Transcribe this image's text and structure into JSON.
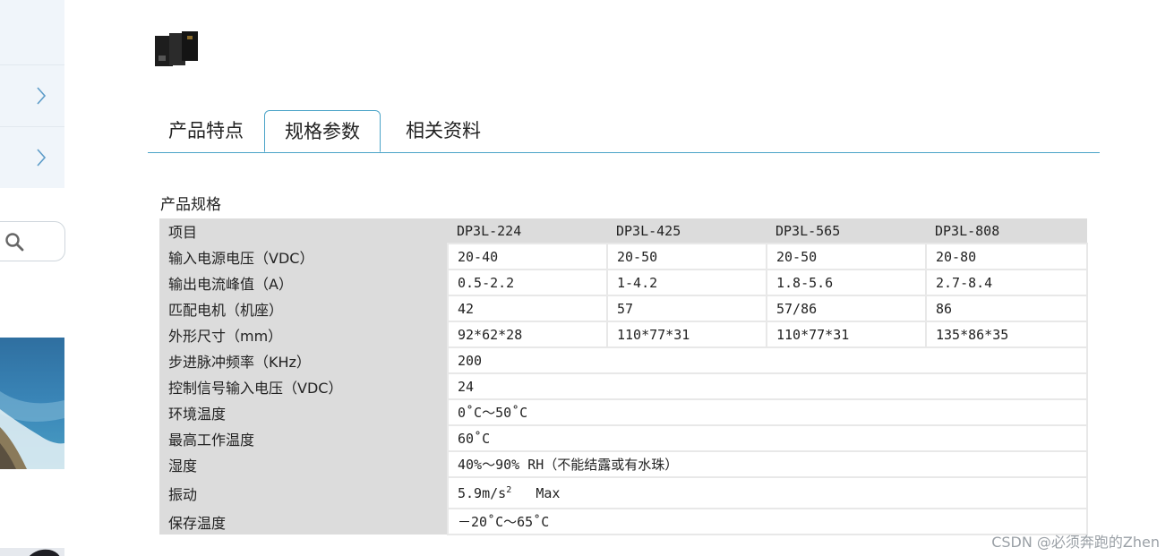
{
  "tabs": [
    {
      "label": "产品特点"
    },
    {
      "label": "规格参数"
    },
    {
      "label": "相关资料"
    }
  ],
  "active_tab": "规格参数",
  "section_title": "产品规格",
  "table": {
    "header": [
      "项目",
      "DP3L-224",
      "DP3L-425",
      "DP3L-565",
      "DP3L-808"
    ],
    "rows": [
      {
        "label": "输入电源电压（VDC）",
        "values": [
          "20-40",
          "20-50",
          "20-50",
          "20-80"
        ]
      },
      {
        "label": "输出电流峰值（A）",
        "values": [
          "0.5-2.2",
          "1-4.2",
          "1.8-5.6",
          "2.7-8.4"
        ]
      },
      {
        "label": "匹配电机（机座）",
        "values": [
          "42",
          "57",
          "57/86",
          "86"
        ]
      },
      {
        "label": "外形尺寸（mm）",
        "values": [
          "92*62*28",
          "110*77*31",
          "110*77*31",
          "135*86*35"
        ]
      },
      {
        "label": "步进脉冲频率（KHz）",
        "value": "200"
      },
      {
        "label": "控制信号输入电压（VDC）",
        "value": "24"
      },
      {
        "label": "环境温度",
        "value": "0˚C～50˚C"
      },
      {
        "label": "最高工作温度",
        "value": "60˚C"
      },
      {
        "label": "湿度",
        "value": "40%～90% RH（不能结露或有水珠）"
      },
      {
        "label": "振动",
        "value_main": "5.9m/s",
        "value_sup": "2",
        "value_tail": "Max"
      },
      {
        "label": "保存温度",
        "value": "－20˚C～65˚C"
      }
    ]
  },
  "watermark": "CSDN @必须奔跑的Zhen",
  "colors": {
    "accent": "#4aa3c7",
    "label_bg": "#dcdcdc",
    "sidebar_bg": "#f0f5fa"
  }
}
